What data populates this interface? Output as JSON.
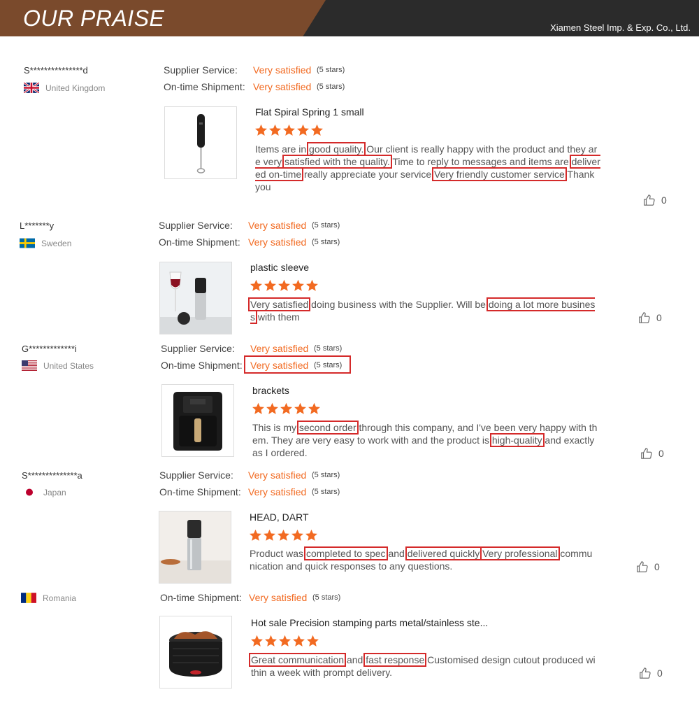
{
  "header": {
    "title": "OUR PRAISE",
    "company": "Xiamen Steel Imp. & Exp. Co., Ltd."
  },
  "labels": {
    "supplier_service": "Supplier Service:",
    "ontime_shipment": "On-time Shipment:"
  },
  "reviews": [
    {
      "buyer": "S***************d",
      "country": "United Kingdom",
      "supplier_value": "Very satisfied",
      "supplier_stars": "(5 stars)",
      "shipment_value": "Very satisfied",
      "shipment_stars": "(5 stars)",
      "product": "Flat Spiral Spring 1 small",
      "rating": 5,
      "text": [
        "Items are in ",
        "good quality.",
        " Our client is really happy with the product and they are very ",
        "satisfied with the quality.",
        " Time to reply to messages and items are ",
        "delivered on-time",
        " really appreciate your service ",
        "Very friendly customer service",
        " Thank you"
      ],
      "likes": "0"
    },
    {
      "buyer": "L*******y",
      "country": "Sweden",
      "supplier_value": "Very satisfied",
      "supplier_stars": "(5 stars)",
      "shipment_value": "Very satisfied",
      "shipment_stars": "(5 stars)",
      "product": "plastic sleeve",
      "rating": 5,
      "text": [
        "",
        "Very satisfied",
        " doing business with the Supplier. Will be ",
        "doing a lot more business",
        " with them"
      ],
      "likes": "0"
    },
    {
      "buyer": "G*************i",
      "country": "United States",
      "supplier_value": "Very satisfied",
      "supplier_stars": "(5 stars)",
      "shipment_value": "Very satisfied",
      "shipment_stars": "(5 stars)",
      "product": "brackets",
      "rating": 5,
      "text": [
        "This is my ",
        "second order",
        " through this company, and I've been very happy with them. They are very easy to work with and the product is ",
        "high-quality",
        " and exactly as I ordered."
      ],
      "likes": "0"
    },
    {
      "buyer": "S**************a",
      "country": "Japan",
      "supplier_value": "Very satisfied",
      "supplier_stars": "(5 stars)",
      "shipment_value": "Very satisfied",
      "shipment_stars": "(5 stars)",
      "product": "HEAD, DART",
      "rating": 5,
      "text": [
        "Product was ",
        "completed to spec",
        " and ",
        "delivered quickly",
        " ",
        "Very professional",
        " communication and quick responses to any questions."
      ],
      "likes": "0"
    },
    {
      "buyer": "",
      "country": "Romania",
      "shipment_value": "Very satisfied",
      "shipment_stars": "(5 stars)",
      "product": "Hot sale Precision stamping parts metal/stainless ste...",
      "rating": 5,
      "text": [
        "",
        "Great communication",
        " and ",
        "fast response",
        " Customised design cutout produced within a week with prompt delivery."
      ],
      "likes": "0"
    }
  ],
  "colors": {
    "accent": "#f26a21",
    "highlight": "#d42a2a",
    "header_brown": "#7a4a2c",
    "header_dark": "#2b2b2b"
  }
}
